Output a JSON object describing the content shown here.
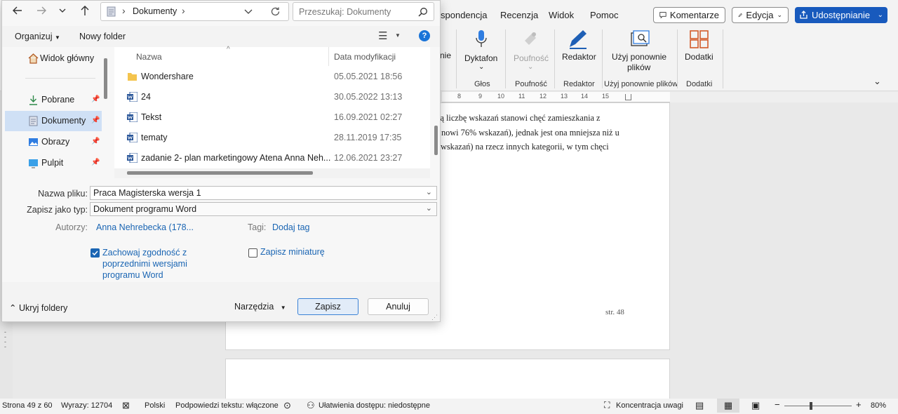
{
  "word": {
    "menu_tabs": [
      "spondencja",
      "Recenzja",
      "Widok",
      "Pomoc"
    ],
    "comment_button": "Komentarze",
    "editing_button": "Edycja",
    "share_button": "Udostępnianie",
    "ribbon": {
      "partial_label": "nie",
      "dictate": "Dyktafon",
      "voice_group": "Głos",
      "sensitivity": "Poufność",
      "sensitivity_group": "Poufność",
      "editor": "Redaktor",
      "editor_group": "Redaktor",
      "reuse_line1": "Użyj ponownie",
      "reuse_line2": "plików",
      "reuse_group": "Użyj ponownie plików",
      "addins": "Dodatki",
      "addins_group": "Dodatki"
    },
    "ruler_marks": [
      "8",
      "9",
      "10",
      "11",
      "12",
      "13",
      "14",
      "15"
    ],
    "document": {
      "lines": [
        "zą liczbę wskazań stanowi chęć zamieszkania z",
        "nowi 76% wskazań), jednak jest ona mniejsza niż u",
        "wskazań) na rzecz innych kategorii, w tym chęci"
      ],
      "page_number": "str. 48"
    },
    "status": {
      "page": "Strona 49 z 60",
      "words": "Wyrazy: 12704",
      "language": "Polski",
      "predictions": "Podpowiedzi tekstu: włączone",
      "accessibility": "Ułatwienia dostępu: niedostępne",
      "focus": "Koncentracja uwagi",
      "zoom": "80%"
    }
  },
  "dialog": {
    "path_root": "›",
    "path_folder": "Dokumenty",
    "search_placeholder": "Przeszukaj: Dokumenty",
    "organize": "Organizuj",
    "new_folder": "Nowy folder",
    "nav_items": [
      {
        "label": "Widok główny",
        "icon": "home-icon"
      },
      {
        "label": "Pobrane",
        "icon": "download-icon"
      },
      {
        "label": "Dokumenty",
        "icon": "documents-icon"
      },
      {
        "label": "Obrazy",
        "icon": "pictures-icon"
      },
      {
        "label": "Pulpit",
        "icon": "desktop-icon"
      }
    ],
    "columns": {
      "name": "Nazwa",
      "modified": "Data modyfikacji"
    },
    "files": [
      {
        "name": "Wondershare",
        "date": "05.05.2021 18:56",
        "type": "folder"
      },
      {
        "name": "24",
        "date": "30.05.2022 13:13",
        "type": "word"
      },
      {
        "name": "Tekst",
        "date": "16.09.2021 02:27",
        "type": "word"
      },
      {
        "name": "tematy",
        "date": "28.11.2019 17:35",
        "type": "word"
      },
      {
        "name": "zadanie 2- plan marketingowy Atena Anna Neh...",
        "date": "12.06.2021 23:27",
        "type": "word"
      }
    ],
    "filename_label": "Nazwa pliku:",
    "filename_value": "Praca Magisterska wersja 1",
    "filetype_label": "Zapisz jako typ:",
    "filetype_value": "Dokument programu Word",
    "authors_label": "Autorzy:",
    "authors_value": "Anna Nehrebecka (178...",
    "tags_label": "Tagi:",
    "tags_value": "Dodaj tag",
    "compat_line1": "Zachowaj zgodność z",
    "compat_line2": "poprzednimi wersjami",
    "compat_line3": "programu Word",
    "thumbnail": "Zapisz miniaturę",
    "hide_folders": "Ukryj foldery",
    "tools": "Narzędzia",
    "save": "Zapisz",
    "cancel": "Anuluj"
  }
}
